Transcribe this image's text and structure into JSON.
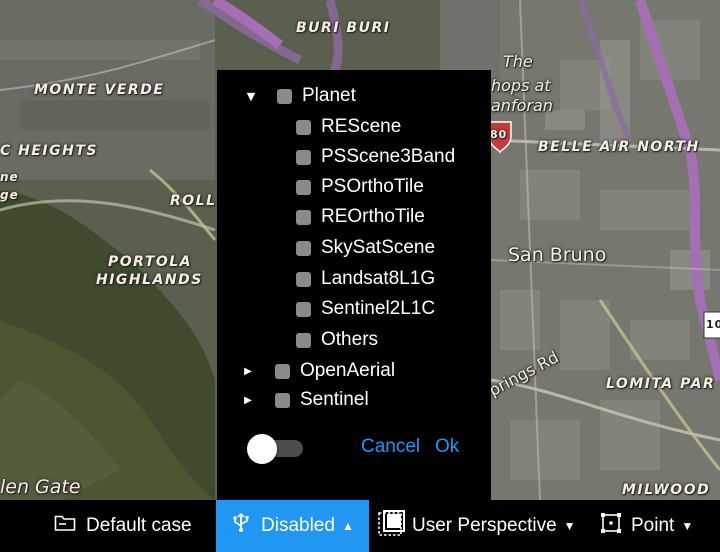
{
  "map": {
    "labels": {
      "buri_buri": "BURI BURI",
      "monte_verde": "MONTE VERDE",
      "c_heights": "C HEIGHTS",
      "ne": "ne",
      "ge": "ge",
      "roll": "ROLL",
      "portola": "PORTOLA",
      "highlands": "HIGHLANDS",
      "the": "The",
      "shops_at": "hops at",
      "tanforan": "anforan",
      "belle_air_north": "BELLE AIR NORTH",
      "san_bruno": "San Bruno",
      "lomita_park": "LOMITA PAR",
      "springs_rd": "prings Rd",
      "milwood": "MILWOOD",
      "glen_gate": "len Gate",
      "interstate_num": "80",
      "highway_num": "10"
    }
  },
  "layer_panel": {
    "root": {
      "label": "Planet",
      "expanded": true
    },
    "planet_children": [
      {
        "label": "REScene"
      },
      {
        "label": "PSScene3Band"
      },
      {
        "label": "PSOrthoTile"
      },
      {
        "label": "REOrthoTile"
      },
      {
        "label": "SkySatScene"
      },
      {
        "label": "Landsat8L1G"
      },
      {
        "label": "Sentinel2L1C"
      },
      {
        "label": "Others"
      }
    ],
    "siblings": [
      {
        "label": "OpenAerial",
        "expanded": false
      },
      {
        "label": "Sentinel",
        "expanded": false
      }
    ],
    "toggle_on": false,
    "cancel_label": "Cancel",
    "ok_label": "Ok",
    "accent_color": "#2196f3"
  },
  "toolbar": {
    "case_label": "Default case",
    "mode_label": "Disabled",
    "perspective_label": "User Perspective",
    "point_label": "Point",
    "active_bg": "#2196f3"
  }
}
